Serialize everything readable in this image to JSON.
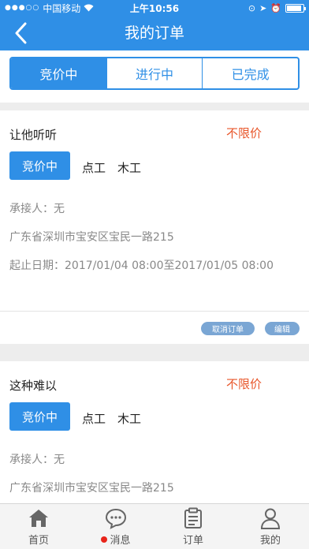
{
  "status_bar": {
    "carrier": "中国移动",
    "time": "上午10:56",
    "signal_icon": "signal-dots-icon",
    "wifi_icon": "wifi-icon"
  },
  "nav": {
    "title": "我的订单",
    "back_icon": "back-chevron-icon"
  },
  "tabs": [
    {
      "label": "竞价中",
      "active": true
    },
    {
      "label": "进行中",
      "active": false
    },
    {
      "label": "已完成",
      "active": false
    }
  ],
  "orders": [
    {
      "name": "让他听听",
      "price": "不限价",
      "status": "竞价中",
      "tags": [
        "点工",
        "木工"
      ],
      "contractor": "承接人：无",
      "address": "广东省深圳市宝安区宝民一路215",
      "dates": "起止日期：2017/01/04 08:00至2017/01/05 08:00",
      "actions": [
        "取消订单",
        "编辑"
      ]
    },
    {
      "name": "这种难以",
      "price": "不限价",
      "status": "竞价中",
      "tags": [
        "点工",
        "木工"
      ],
      "contractor": "承接人：无",
      "address": "广东省深圳市宝安区宝民一路215"
    }
  ],
  "tabbar": [
    {
      "label": "首页",
      "icon": "home-icon"
    },
    {
      "label": "消息",
      "icon": "chat-bubble-icon",
      "badge": true
    },
    {
      "label": "订单",
      "icon": "clipboard-icon"
    },
    {
      "label": "我的",
      "icon": "person-icon"
    }
  ],
  "colors": {
    "primary": "#2f8fe6",
    "price": "#e8562a",
    "badge": "#e8241a"
  }
}
